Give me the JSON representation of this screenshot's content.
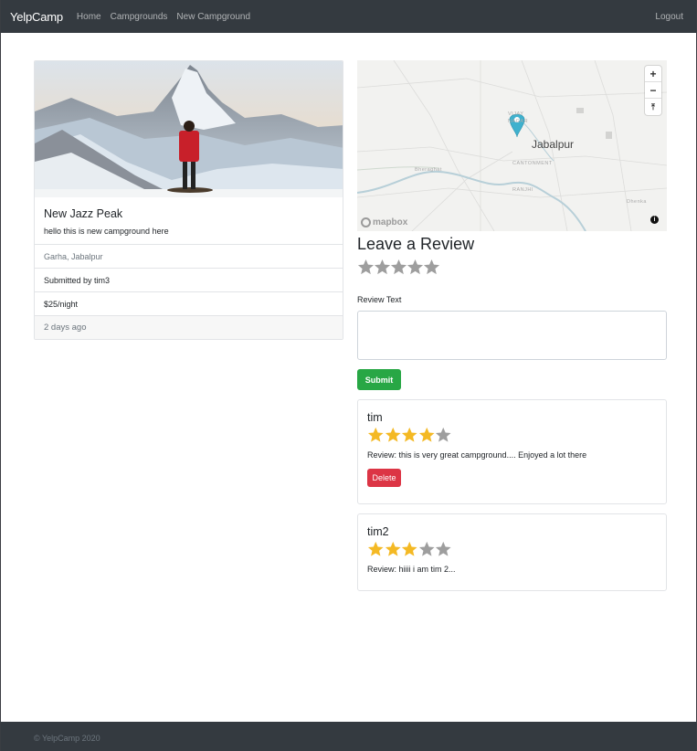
{
  "navbar": {
    "brand": "YelpCamp",
    "links": {
      "home": "Home",
      "campgrounds": "Campgrounds",
      "new_campground": "New Campground"
    },
    "logout": "Logout",
    "background": "#343a40"
  },
  "campground": {
    "image_description_icon": "mountain-photo",
    "title": "New Jazz Peak",
    "description": "hello this is new campground here",
    "location": "Garha, Jabalpur",
    "submitted_by": "Submitted by tim3",
    "price": "$25/night",
    "posted": "2 days ago"
  },
  "map": {
    "city": "Jabalpur",
    "labels": {
      "vijay_nagar_1": "VIJAY",
      "vijay_nagar_2": "NAGAR",
      "cantonment": "CANTONMENT",
      "bheraghat": "Bheraghat",
      "ranjhi": "RANJHI",
      "dhenka": "Dhenka"
    },
    "zoom_in": "+",
    "zoom_out": "−",
    "compass": "⤒",
    "attribution": "mapbox",
    "info": "i",
    "marker_color": "#3fb1ce"
  },
  "review_form": {
    "heading": "Leave a Review",
    "rating": 0,
    "max_rating": 5,
    "text_label": "Review Text",
    "text_value": "",
    "submit_label": "Submit"
  },
  "reviews": [
    {
      "user": "tim",
      "rating": 4,
      "text": "Review: this is very great campground.... Enjoyed a lot there",
      "delete_label": "Delete"
    },
    {
      "user": "tim2",
      "rating": 3,
      "text": "Review: hiiii i am tim 2..."
    }
  ],
  "colors": {
    "star_filled": "#f4b924",
    "star_empty": "#9e9e9e",
    "submit": "#28a745",
    "delete": "#dc3545"
  },
  "footer": {
    "text": "© YelpCamp 2020"
  }
}
